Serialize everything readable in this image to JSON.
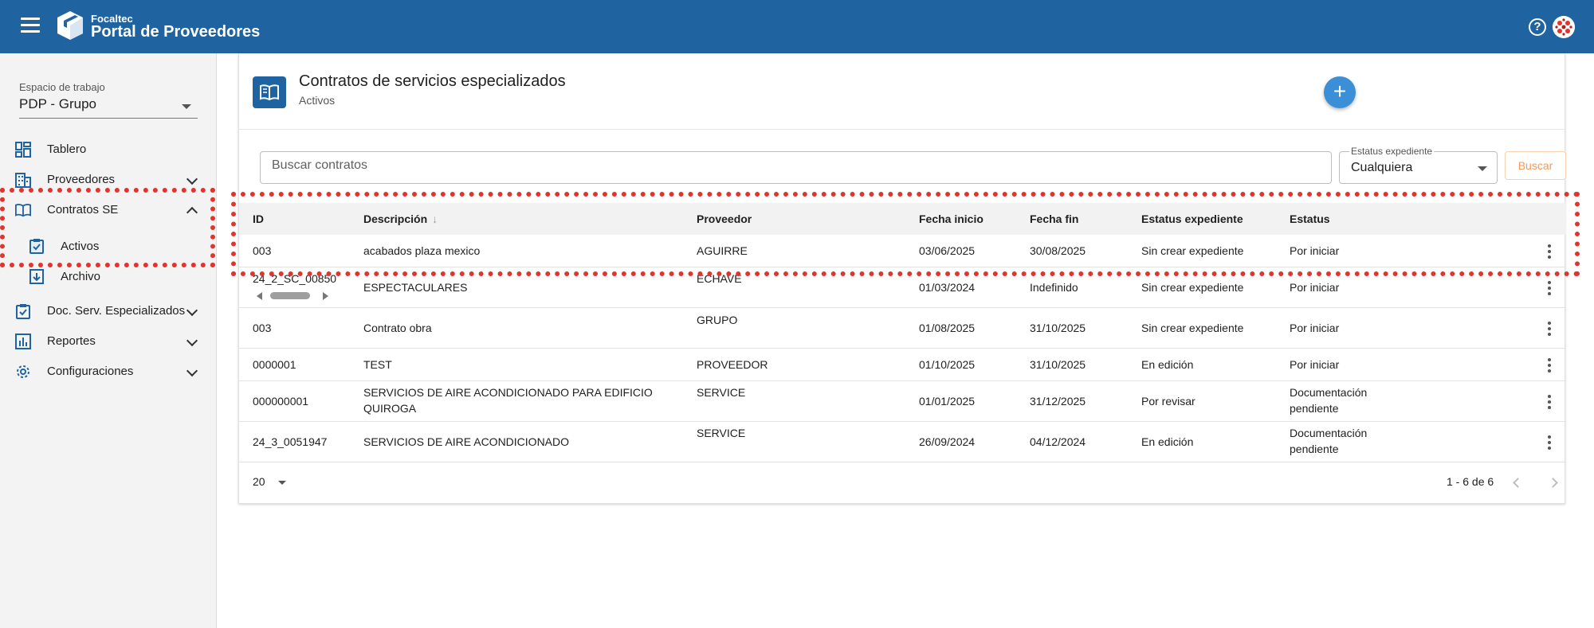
{
  "header": {
    "brand_small": "Focaltec",
    "brand_large": "Portal de Proveedores",
    "help_label": "?"
  },
  "sidebar": {
    "workspace_label": "Espacio de trabajo",
    "workspace_value": "PDP - Grupo",
    "items": [
      {
        "label": "Tablero",
        "icon": "dashboard-icon"
      },
      {
        "label": "Proveedores",
        "icon": "building-icon"
      },
      {
        "label": "Contratos SE",
        "icon": "book-icon"
      },
      {
        "label": "Activos",
        "icon": "clipboard-check-icon"
      },
      {
        "label": "Archivo",
        "icon": "archive-icon"
      },
      {
        "label": "Doc. Serv. Especializados",
        "icon": "clipboard-check-icon"
      },
      {
        "label": "Reportes",
        "icon": "bar-chart-icon"
      },
      {
        "label": "Configuraciones",
        "icon": "gear-icon"
      }
    ]
  },
  "main": {
    "title": "Contratos de servicios especializados",
    "subtitle": "Activos",
    "add_label": "+",
    "search_placeholder": "Buscar contratos",
    "status_filter_label": "Estatus expediente",
    "status_filter_value": "Cualquiera",
    "search_button": "Buscar",
    "columns": [
      "ID",
      "Descripción",
      "Proveedor",
      "Fecha inicio",
      "Fecha fin",
      "Estatus expediente",
      "Estatus"
    ],
    "sort_indicator": "↓",
    "rows": [
      {
        "id": "003",
        "desc": "acabados plaza mexico",
        "prov": "AGUIRRE",
        "inicio": "03/06/2025",
        "fin": "30/08/2025",
        "exp": "Sin crear expediente",
        "status": "Por iniciar"
      },
      {
        "id": "24_2_SC_00850",
        "desc": "ESPECTACULARES",
        "prov": "ECHAVE",
        "inicio": "01/03/2024",
        "fin": "Indefinido",
        "exp": "Sin crear expediente",
        "status": "Por iniciar"
      },
      {
        "id": "003",
        "desc": "Contrato obra",
        "prov": "GRUPO",
        "inicio": "01/08/2025",
        "fin": "31/10/2025",
        "exp": "Sin crear expediente",
        "status": "Por iniciar"
      },
      {
        "id": "0000001",
        "desc": "TEST",
        "prov": "PROVEEDOR",
        "inicio": "01/10/2025",
        "fin": "31/10/2025",
        "exp": "En edición",
        "status": "Por iniciar"
      },
      {
        "id": "000000001",
        "desc": "SERVICIOS DE AIRE ACONDICIONADO PARA EDIFICIO QUIROGA",
        "prov": "SERVICE",
        "inicio": "01/01/2025",
        "fin": "31/12/2025",
        "exp": "Por revisar",
        "status": "Documentación pendiente"
      },
      {
        "id": "24_3_0051947",
        "desc": "SERVICIOS DE AIRE ACONDICIONADO",
        "prov": "SERVICE",
        "inicio": "26/09/2024",
        "fin": "04/12/2024",
        "exp": "En edición",
        "status": "Documentación pendiente"
      }
    ],
    "per_page": "20",
    "range": "1 - 6 de 6"
  },
  "colors": {
    "header": "#1f64a0",
    "fab": "#3b8fd6",
    "search_button": "#f29a5a",
    "annotation": "#e0342c"
  }
}
